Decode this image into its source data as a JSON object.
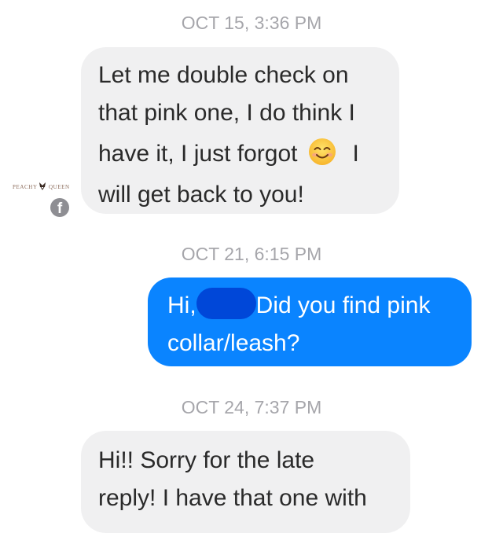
{
  "messages": [
    {
      "timestamp": "OCT 15, 3:36 PM",
      "lines": [
        "Let me double check on",
        "that pink one, I do think I",
        "have it, I just forgot",
        "I",
        "will get back to you!"
      ]
    },
    {
      "timestamp": "OCT 21, 6:15 PM",
      "line1_start": "Hi,",
      "line1_end": "Did you find pink",
      "line2": "collar/leash?"
    },
    {
      "timestamp": "OCT 24, 7:37 PM",
      "lines": [
        "Hi!! Sorry for the late",
        "reply! I have that one with"
      ]
    }
  ],
  "avatar": {
    "logo_text": "PEACHY QUEEN",
    "badge_icon": "facebook-icon"
  },
  "colors": {
    "incoming_bubble": "#f0f0f1",
    "outgoing_bubble": "#0a84ff",
    "timestamp": "#a6a6ab"
  }
}
